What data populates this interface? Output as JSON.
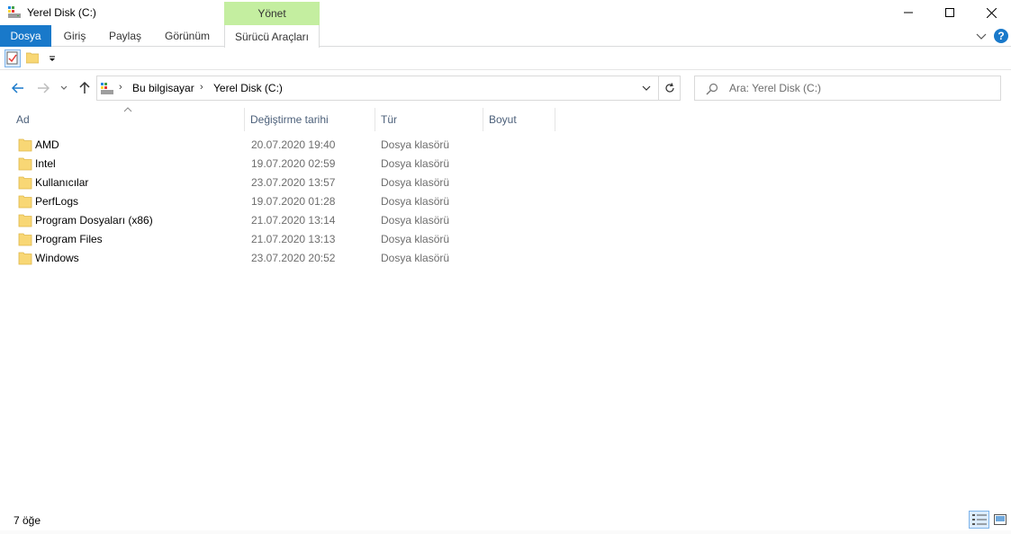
{
  "window": {
    "title": "Yerel Disk (C:)",
    "contextual_tab_header": "Yönet"
  },
  "ribbon": {
    "tabs": [
      {
        "label": "Dosya"
      },
      {
        "label": "Giriş"
      },
      {
        "label": "Paylaş"
      },
      {
        "label": "Görünüm"
      },
      {
        "label": "Sürücü Araçları"
      }
    ],
    "help_label": "?"
  },
  "navigation": {
    "breadcrumb": [
      "Bu bilgisayar",
      "Yerel Disk (C:)"
    ],
    "search_placeholder": "Ara: Yerel Disk (C:)"
  },
  "columns": {
    "name": "Ad",
    "date": "Değiştirme tarihi",
    "type": "Tür",
    "size": "Boyut"
  },
  "files": [
    {
      "name": "AMD",
      "modified": "20.07.2020 19:40",
      "type": "Dosya klasörü"
    },
    {
      "name": "Intel",
      "modified": "19.07.2020 02:59",
      "type": "Dosya klasörü"
    },
    {
      "name": "Kullanıcılar",
      "modified": "23.07.2020 13:57",
      "type": "Dosya klasörü"
    },
    {
      "name": "PerfLogs",
      "modified": "19.07.2020 01:28",
      "type": "Dosya klasörü"
    },
    {
      "name": "Program Dosyaları (x86)",
      "modified": "21.07.2020 13:14",
      "type": "Dosya klasörü"
    },
    {
      "name": "Program Files",
      "modified": "21.07.2020 13:13",
      "type": "Dosya klasörü"
    },
    {
      "name": "Windows",
      "modified": "23.07.2020 20:52",
      "type": "Dosya klasörü"
    }
  ],
  "status": {
    "item_count": "7 öğe"
  },
  "colors": {
    "accent": "#1979ca",
    "contextual_tab": "#c4eea0",
    "folder": "#f8d775",
    "header_text": "#4c607a"
  }
}
